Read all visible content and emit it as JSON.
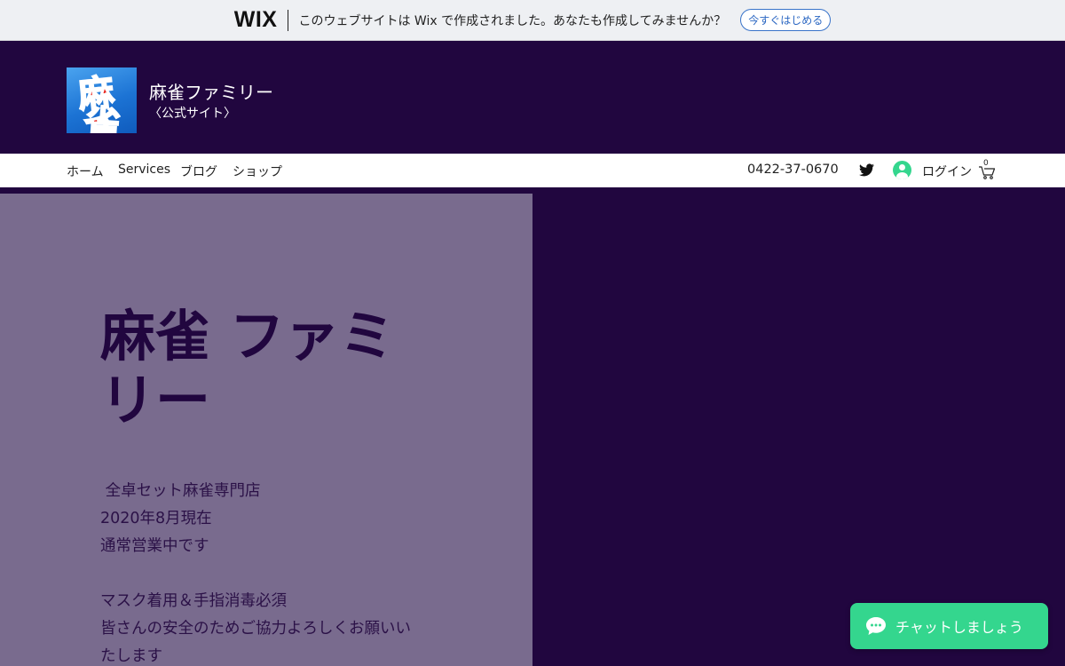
{
  "wix_banner": {
    "logo": "WIX",
    "message": "このウェブサイトは Wix で作成されました。あなたも作成してみませんか？",
    "cta": "今すぐはじめる"
  },
  "header": {
    "logo_chars": [
      "麻",
      "雀"
    ],
    "title": "麻雀ファミリー",
    "subtitle": "〈公式サイト〉"
  },
  "nav": {
    "items": [
      "ホーム",
      "Services",
      "ブログ",
      "ショップ"
    ],
    "phone": "0422-37-0670",
    "login": "ログイン",
    "cart_count": "0"
  },
  "hero": {
    "title_line1": "麻雀 ファミ",
    "title_line2": "リー",
    "lines": [
      " 全卓セット麻雀専門店",
      "2020年8月現在",
      "通常営業中です",
      "",
      "マスク着用＆手指消毒必須",
      "皆さんの安全のためご協力よろしくお願いい",
      "たします"
    ]
  },
  "chat": {
    "label": "チャットしましょう"
  },
  "colors": {
    "header_bg": "#21063f",
    "hero_panel": "#796b8e",
    "chat_green": "#34d68e",
    "banner_bg": "#eef0f3"
  }
}
